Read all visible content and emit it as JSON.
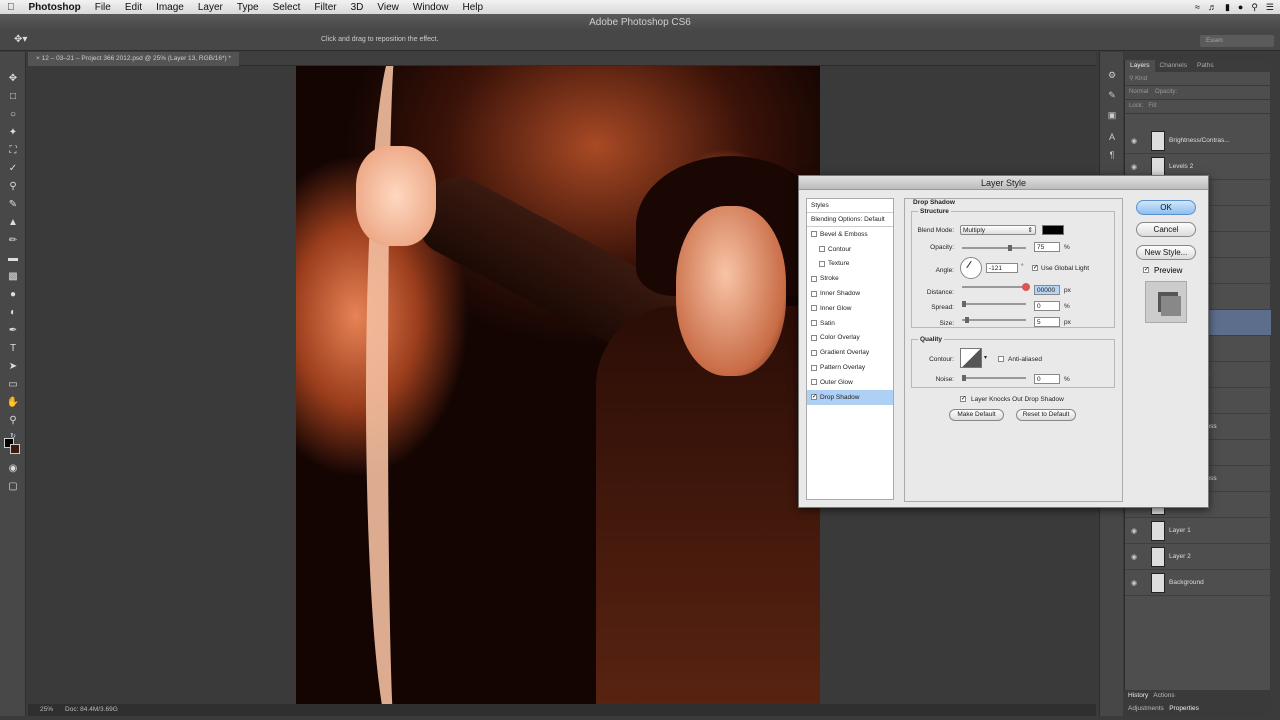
{
  "mac_menu": {
    "app": "Photoshop",
    "items": [
      "File",
      "Edit",
      "Image",
      "Layer",
      "Type",
      "Select",
      "Filter",
      "3D",
      "View",
      "Window",
      "Help"
    ]
  },
  "app_title": "Adobe Photoshop CS6",
  "options": {
    "hint": "Click and drag to reposition the effect.",
    "workspace": "Essen"
  },
  "document_tab": "12 – 03–21 – Project 366 2012.psd @ 25% (Layer 13, RGB/16*) *",
  "status": {
    "zoom": "25%",
    "doc": "Doc: 84.4M/3.69G"
  },
  "layers_panel": {
    "tabs": [
      "Layers",
      "Channels",
      "Paths"
    ],
    "kind": "Kind",
    "blend": "Normal",
    "opacity_label": "Opacity:",
    "lock_label": "Lock:",
    "fill_label": "Fill:",
    "rows": [
      "Brightness/Contras...",
      "Levels 2",
      "els 1",
      "ves 2",
      "ves 3",
      "e/Saturation 2",
      "",
      "",
      "ves 1",
      "e/Saturation 3",
      "",
      "Bevel & Emboss",
      "",
      "Bevel & Emboss",
      "Layer 6",
      "Layer 1",
      "Layer 2",
      "Background"
    ],
    "bottom_tabs": [
      "History",
      "Actions",
      "Adjustments",
      "Properties"
    ]
  },
  "dialog": {
    "title": "Layer Style",
    "styles_header": "Styles",
    "blending": "Blending Options: Default",
    "styles": [
      {
        "label": "Bevel & Emboss",
        "checked": false,
        "sub": false
      },
      {
        "label": "Contour",
        "checked": false,
        "sub": true
      },
      {
        "label": "Texture",
        "checked": false,
        "sub": true
      },
      {
        "label": "Stroke",
        "checked": false,
        "sub": false
      },
      {
        "label": "Inner Shadow",
        "checked": false,
        "sub": false
      },
      {
        "label": "Inner Glow",
        "checked": false,
        "sub": false
      },
      {
        "label": "Satin",
        "checked": false,
        "sub": false
      },
      {
        "label": "Color Overlay",
        "checked": false,
        "sub": false
      },
      {
        "label": "Gradient Overlay",
        "checked": false,
        "sub": false
      },
      {
        "label": "Pattern Overlay",
        "checked": false,
        "sub": false
      },
      {
        "label": "Outer Glow",
        "checked": false,
        "sub": false
      },
      {
        "label": "Drop Shadow",
        "checked": true,
        "sub": false
      }
    ],
    "section": "Drop Shadow",
    "structure": "Structure",
    "blend_mode_label": "Blend Mode:",
    "blend_mode": "Multiply",
    "opacity_label": "Opacity:",
    "opacity": "75",
    "angle_label": "Angle:",
    "angle": "-121",
    "degree": "°",
    "global_light": "Use Global Light",
    "distance_label": "Distance:",
    "distance": "00000",
    "spread_label": "Spread:",
    "spread": "0",
    "size_label": "Size:",
    "size": "5",
    "px": "px",
    "pct": "%",
    "quality": "Quality",
    "contour_label": "Contour:",
    "anti_aliased": "Anti-aliased",
    "noise_label": "Noise:",
    "noise": "0",
    "knockout": "Layer Knocks Out Drop Shadow",
    "make_default": "Make Default",
    "reset_default": "Reset to Default",
    "ok": "OK",
    "cancel": "Cancel",
    "new_style": "New Style...",
    "preview": "Preview"
  }
}
